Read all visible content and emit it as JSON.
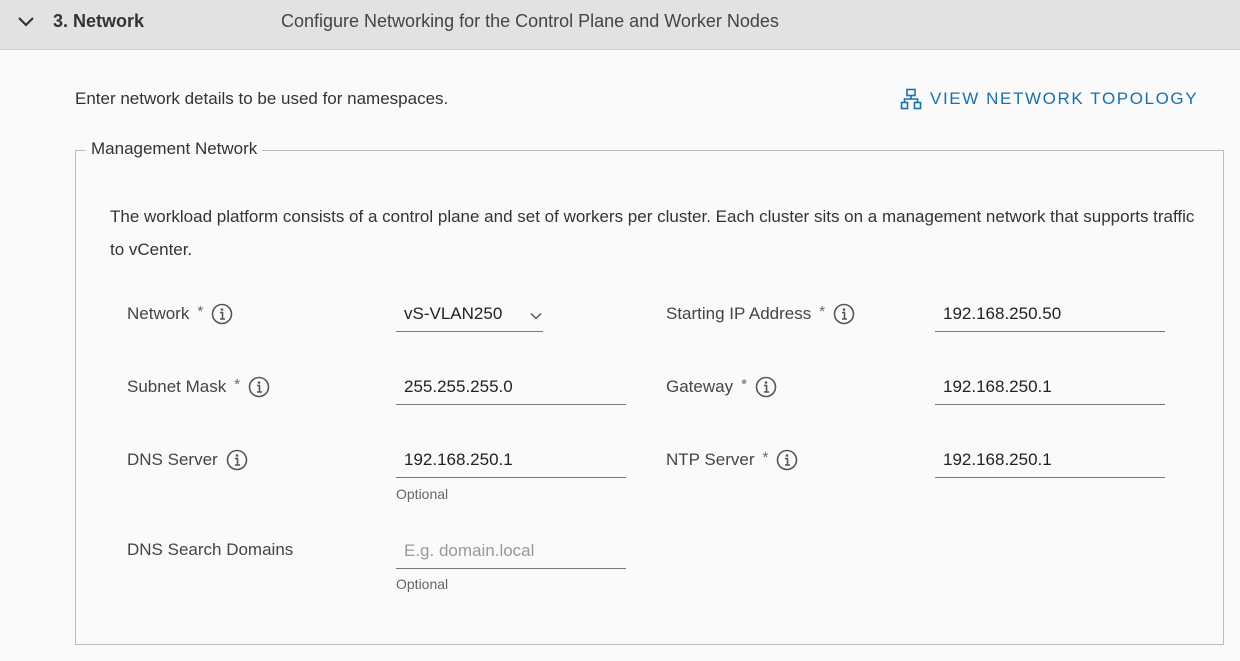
{
  "header": {
    "step_title": "3. Network",
    "step_description": "Configure Networking for the Control Plane and Worker Nodes"
  },
  "intro_text": "Enter network details to be used for namespaces.",
  "topology_link": "VIEW NETWORK TOPOLOGY",
  "management": {
    "legend": "Management Network",
    "description": "The workload platform consists of a control plane and set of workers per cluster. Each cluster sits on a management network that supports traffic to vCenter.",
    "required_mark": "*",
    "fields": {
      "network": {
        "label": "Network",
        "value": "vS-VLAN250"
      },
      "starting_ip": {
        "label": "Starting IP Address",
        "value": "192.168.250.50"
      },
      "subnet_mask": {
        "label": "Subnet Mask",
        "value": "255.255.255.0"
      },
      "gateway": {
        "label": "Gateway",
        "value": "192.168.250.1"
      },
      "dns_server": {
        "label": "DNS Server",
        "value": "192.168.250.1",
        "helper": "Optional"
      },
      "ntp_server": {
        "label": "NTP Server",
        "value": "192.168.250.1"
      },
      "dns_search_domains": {
        "label": "DNS Search Domains",
        "placeholder": "E.g. domain.local",
        "helper": "Optional"
      }
    }
  },
  "colors": {
    "link": "#1a6fae",
    "header_bg": "#e2e2e2"
  }
}
